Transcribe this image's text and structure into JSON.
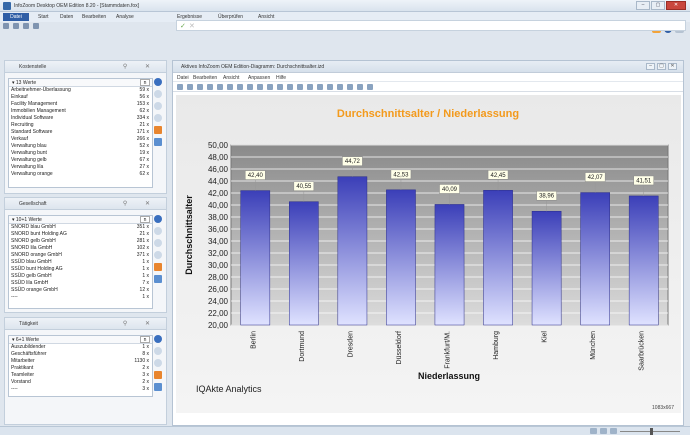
{
  "window": {
    "title": "InfoZoom Desktop OEM Edition 8.20 - [Stammdaten.fox]",
    "buttons": [
      "–",
      "▢",
      "✕"
    ]
  },
  "ribbon": {
    "file_tab": "Datei",
    "tabs": [
      "Start",
      "Daten",
      "Bearbeiten",
      "Analyse",
      "Ergebnisse",
      "Überprüfen",
      "Ansicht"
    ]
  },
  "panels": [
    {
      "title": "Kostenstelle",
      "header": "13 Werte",
      "n_label": "n",
      "rows": [
        {
          "label": "Arbeitnehmer-Überlassung",
          "count": "59 x"
        },
        {
          "label": "Einkauf",
          "count": "56 x"
        },
        {
          "label": "Facility Management",
          "count": "153 x"
        },
        {
          "label": "Immobilien Management",
          "count": "62 x"
        },
        {
          "label": "Individual Software",
          "count": "334 x"
        },
        {
          "label": "Recruiting",
          "count": "21 x"
        },
        {
          "label": "Standard Software",
          "count": "171 x"
        },
        {
          "label": "Verkauf",
          "count": "266 x"
        },
        {
          "label": "Verwaltung blau",
          "count": "52 x"
        },
        {
          "label": "Verwaltung bunt",
          "count": "19 x"
        },
        {
          "label": "Verwaltung gelb",
          "count": "67 x"
        },
        {
          "label": "Verwaltung lila",
          "count": "27 x"
        },
        {
          "label": "Verwaltung orange",
          "count": "62 x"
        }
      ]
    },
    {
      "title": "Gesellschaft",
      "header": "10+1 Werte",
      "n_label": "n",
      "rows": [
        {
          "label": "SNORD blau GmbH",
          "count": "351 x"
        },
        {
          "label": "SNORD bunt Holding AG",
          "count": "21 x"
        },
        {
          "label": "SNORD gelb GmbH",
          "count": "281 x"
        },
        {
          "label": "SNORD lila GmbH",
          "count": "102 x"
        },
        {
          "label": "SNORD orange GmbH",
          "count": "371 x"
        },
        {
          "label": "SSÜD blau GmbH",
          "count": "1 x"
        },
        {
          "label": "SSÜD bunt Holding AG",
          "count": "1 x"
        },
        {
          "label": "SSÜD gelb GmbH",
          "count": "1 x"
        },
        {
          "label": "SSÜD lila GmbH",
          "count": "7 x"
        },
        {
          "label": "SSÜD orange GmbH",
          "count": "12 x"
        },
        {
          "label": "----",
          "count": "1 x"
        }
      ]
    },
    {
      "title": "Tätigkeit",
      "header": "6+1 Werte",
      "n_label": "n",
      "rows": [
        {
          "label": "Auszubildender",
          "count": "1 x"
        },
        {
          "label": "Geschäftsführer",
          "count": "8 x"
        },
        {
          "label": "Mitarbeiter",
          "count": "1130 x"
        },
        {
          "label": "Praktikant",
          "count": "2 x"
        },
        {
          "label": "Teamleiter",
          "count": "3 x"
        },
        {
          "label": "Vorstand",
          "count": "2 x"
        },
        {
          "label": "----",
          "count": "3 x"
        }
      ]
    }
  ],
  "mdi": {
    "title": "Aktives InfoZoom OEM Edition-Diagramm: Durchschnittsalter.izd",
    "menu": [
      "Datei",
      "Bearbeiten",
      "Ansicht",
      "Anpassen",
      "Hilfe"
    ],
    "watermark": "IQAkte Analytics",
    "size_label": "1083x667"
  },
  "chart_data": {
    "type": "bar",
    "title": "Durchschnittsalter / Niederlassung",
    "xlabel": "Niederlassung",
    "ylabel": "Durchschnittsalter",
    "ylim": [
      20,
      50
    ],
    "yticks": [
      "20,00",
      "22,00",
      "24,00",
      "26,00",
      "28,00",
      "30,00",
      "32,00",
      "34,00",
      "36,00",
      "38,00",
      "40,00",
      "42,00",
      "44,00",
      "46,00",
      "48,00",
      "50,00"
    ],
    "categories": [
      "Berlin",
      "Dortmund",
      "Dresden",
      "Düsseldorf",
      "Frankfurt/M.",
      "Hamburg",
      "Kiel",
      "München",
      "Saarbrücken"
    ],
    "values": [
      42.4,
      40.55,
      44.72,
      42.53,
      40.09,
      42.45,
      38.96,
      42.07,
      41.51
    ],
    "value_labels": [
      "42,40",
      "40,55",
      "44,72",
      "42,53",
      "40,09",
      "42,45",
      "38,96",
      "42,07",
      "41,51"
    ],
    "colors": {
      "bar_top": "#3b3fb8",
      "bar_bottom": "#dfe2ff",
      "title": "#f39a1c"
    }
  }
}
